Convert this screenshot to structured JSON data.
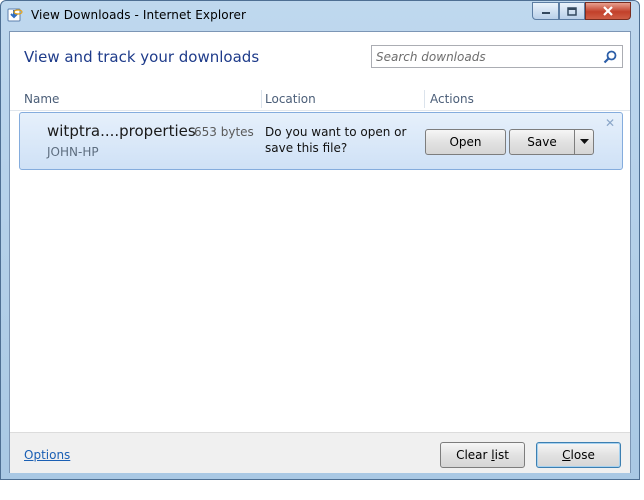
{
  "window": {
    "title": "View Downloads - Internet Explorer",
    "controls": {
      "minimize": "minimize-icon",
      "maximize": "maximize-icon",
      "close": "close-icon"
    }
  },
  "header": {
    "title": "View and track your downloads",
    "search": {
      "placeholder": "Search downloads",
      "value": "",
      "icon": "search-icon"
    }
  },
  "columns": [
    {
      "label": "Name"
    },
    {
      "label": "Location"
    },
    {
      "label": "Actions"
    }
  ],
  "downloads": [
    {
      "filename": "witptra....properties",
      "size": "653 bytes",
      "source": "JOHN-HP",
      "prompt": "Do you want to open or save this file?",
      "actions": {
        "open": "Open",
        "save": "Save"
      }
    }
  ],
  "footer": {
    "options_link": "Options",
    "clear_list": {
      "before": "Clear ",
      "accel": "l",
      "after": "ist"
    },
    "close": {
      "before": "",
      "accel": "C",
      "after": "lose"
    }
  },
  "colors": {
    "accent": "#1e3b8a",
    "row_highlight": "#cfe1f6",
    "link": "#1a5fb4"
  }
}
